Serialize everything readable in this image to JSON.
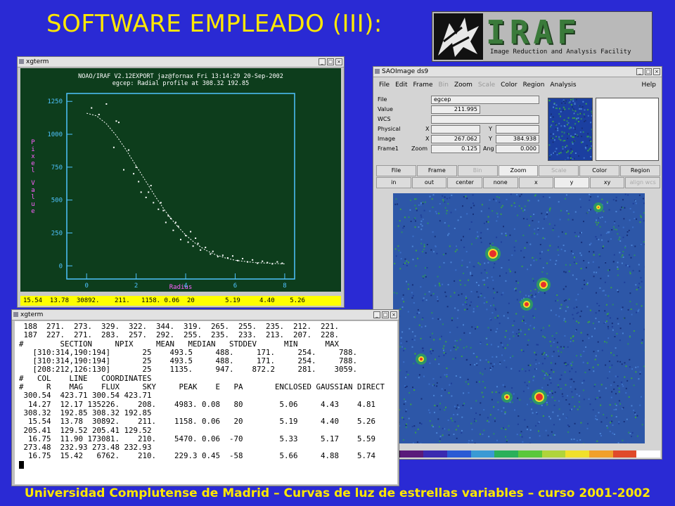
{
  "slide": {
    "title": "SOFTWARE EMPLEADO (III):",
    "footer": "Universidad Complutense de Madrid – Curvas de luz de estrellas variables – curso 2001-2002"
  },
  "logo": {
    "text": "IRAF",
    "subtitle": "Image Reduction and Analysis Facility"
  },
  "plot_window": {
    "title": "xgterm",
    "header1": "NOAO/IRAF V2.12EXPORT jaz@fornax Fri 13:14:29 20-Sep-2002",
    "header2": "egcep: Radial profile at 308.32 192.85",
    "ylabel": "Pixel Value",
    "xlabel": "Radius",
    "status": "15.54  13.78  30892.    211.   1158. 0.06  20        5.19     4.40    5.26"
  },
  "chart_data": {
    "type": "scatter",
    "title": "egcep: Radial profile at 308.32 192.85",
    "xlabel": "Radius",
    "ylabel": "Pixel Value",
    "xlim": [
      -0.8,
      8.4
    ],
    "ylim": [
      -100,
      1310
    ],
    "xticks": [
      0,
      2,
      4,
      6,
      8
    ],
    "yticks": [
      0,
      250,
      500,
      750,
      1000,
      1250
    ],
    "axis_color": "#4fc3ff",
    "point_color": "#ffffff",
    "fit_curve": {
      "x": [
        0,
        0.4,
        0.8,
        1.2,
        1.6,
        2.0,
        2.4,
        2.8,
        3.2,
        3.6,
        4.0,
        4.4,
        4.8,
        5.2,
        5.6,
        6.0,
        6.8,
        7.6,
        8.0
      ],
      "y": [
        1160,
        1140,
        1080,
        990,
        880,
        760,
        640,
        520,
        410,
        315,
        235,
        170,
        120,
        85,
        60,
        42,
        25,
        18,
        15
      ]
    },
    "points": {
      "x": [
        0.2,
        0.5,
        0.8,
        1.1,
        1.3,
        1.5,
        1.7,
        1.9,
        2.1,
        2.2,
        2.4,
        2.6,
        2.7,
        2.9,
        3.1,
        3.2,
        3.4,
        3.5,
        3.7,
        3.8,
        4.0,
        4.1,
        4.3,
        4.5,
        4.6,
        4.8,
        5.0,
        5.1,
        5.3,
        5.5,
        5.7,
        5.9,
        6.1,
        6.3,
        6.5,
        6.7,
        6.9,
        7.1,
        7.3,
        7.5,
        7.7,
        7.9,
        3.0,
        3.3,
        4.2,
        4.4,
        2.5,
        1.2,
        2.0,
        3.6
      ],
      "y": [
        1200,
        1150,
        1230,
        900,
        1090,
        730,
        880,
        700,
        640,
        560,
        520,
        610,
        480,
        430,
        420,
        330,
        360,
        270,
        300,
        200,
        230,
        180,
        150,
        170,
        120,
        140,
        90,
        110,
        70,
        80,
        60,
        75,
        40,
        55,
        30,
        45,
        20,
        35,
        25,
        15,
        30,
        20,
        480,
        380,
        260,
        210,
        560,
        1100,
        750,
        330
      ]
    }
  },
  "ds9_window": {
    "title": "SAOImage ds9",
    "menu": [
      "File",
      "Edit",
      "Frame",
      "Bin",
      "Zoom",
      "Scale",
      "Color",
      "Region",
      "Analysis",
      "Help"
    ],
    "menu_disabled": [
      false,
      false,
      false,
      true,
      false,
      true,
      false,
      false,
      false,
      false
    ],
    "info": {
      "file_label": "File",
      "file_value": "egcep",
      "value_label": "Value",
      "value": "211.995",
      "wcs_label": "WCS",
      "physical_label": "Physical",
      "x_label": "X",
      "y_label": "Y",
      "image_label": "Image",
      "image_x": "267.062",
      "image_y": "384.938",
      "frame_label": "Frame1",
      "zoom_label": "Zoom",
      "zoom": "0.125",
      "ang_label": "Ang",
      "ang": "0.000"
    },
    "buttons_row1": [
      "File",
      "Frame",
      "Bin",
      "Zoom",
      "Scale",
      "Color",
      "Region"
    ],
    "buttons_row1_dim": [
      false,
      false,
      true,
      false,
      true,
      false,
      false
    ],
    "buttons_row2": [
      "in",
      "out",
      "center",
      "none",
      "x",
      "y",
      "xy",
      "align wcs"
    ],
    "buttons_row2_dim": [
      false,
      false,
      false,
      false,
      false,
      false,
      false,
      true
    ],
    "colorbar": [
      "#2a0a3a",
      "#5a1a7a",
      "#3a2ab0",
      "#2a5ad4",
      "#3a9ad4",
      "#2ab05a",
      "#5ac83a",
      "#b0d43a",
      "#f0e02a",
      "#f0a02a",
      "#e04a2a",
      "#ffffff"
    ]
  },
  "terminal": {
    "title": "xgterm",
    "lines": [
      " 188  271.  273.  329.  322.  344.  319.  265.  255.  235.  212.  221.",
      " 187  227.  271.  283.  257.  292.  255.  235.  233.  213.  207.  228.",
      "#        SECTION     NPIX     MEAN   MEDIAN   STDDEV      MIN      MAX",
      "   [310:314,190:194]       25    493.5     488.     171.     254.     788.",
      "   [310:314,190:194]       25    493.5     488.     171.     254.     788.",
      "   [208:212,126:130]       25    1135.     947.    872.2     281.    3059.",
      "#   COL    LINE   COORDINATES",
      "#     R    MAG    FLUX     SKY     PEAK    E   PA       ENCLOSED GAUSSIAN DIRECT",
      " 300.54  423.71 300.54 423.71",
      "  14.27  12.17 135226.    208.    4983. 0.08   80        5.06     4.43    4.81",
      " 308.32  192.85 308.32 192.85",
      "  15.54  13.78  30892.    211.    1158. 0.06   20        5.19     4.40    5.26",
      " 205.41  129.52 205.41 129.52",
      "  16.75  11.90 173081.    210.    5470. 0.06  -70        5.33     5.17    5.59",
      " 273.48  232.93 273.48 232.93",
      "  16.75  15.42   6762.    210.    229.3 0.45  -58        5.66     4.88    5.74"
    ]
  }
}
